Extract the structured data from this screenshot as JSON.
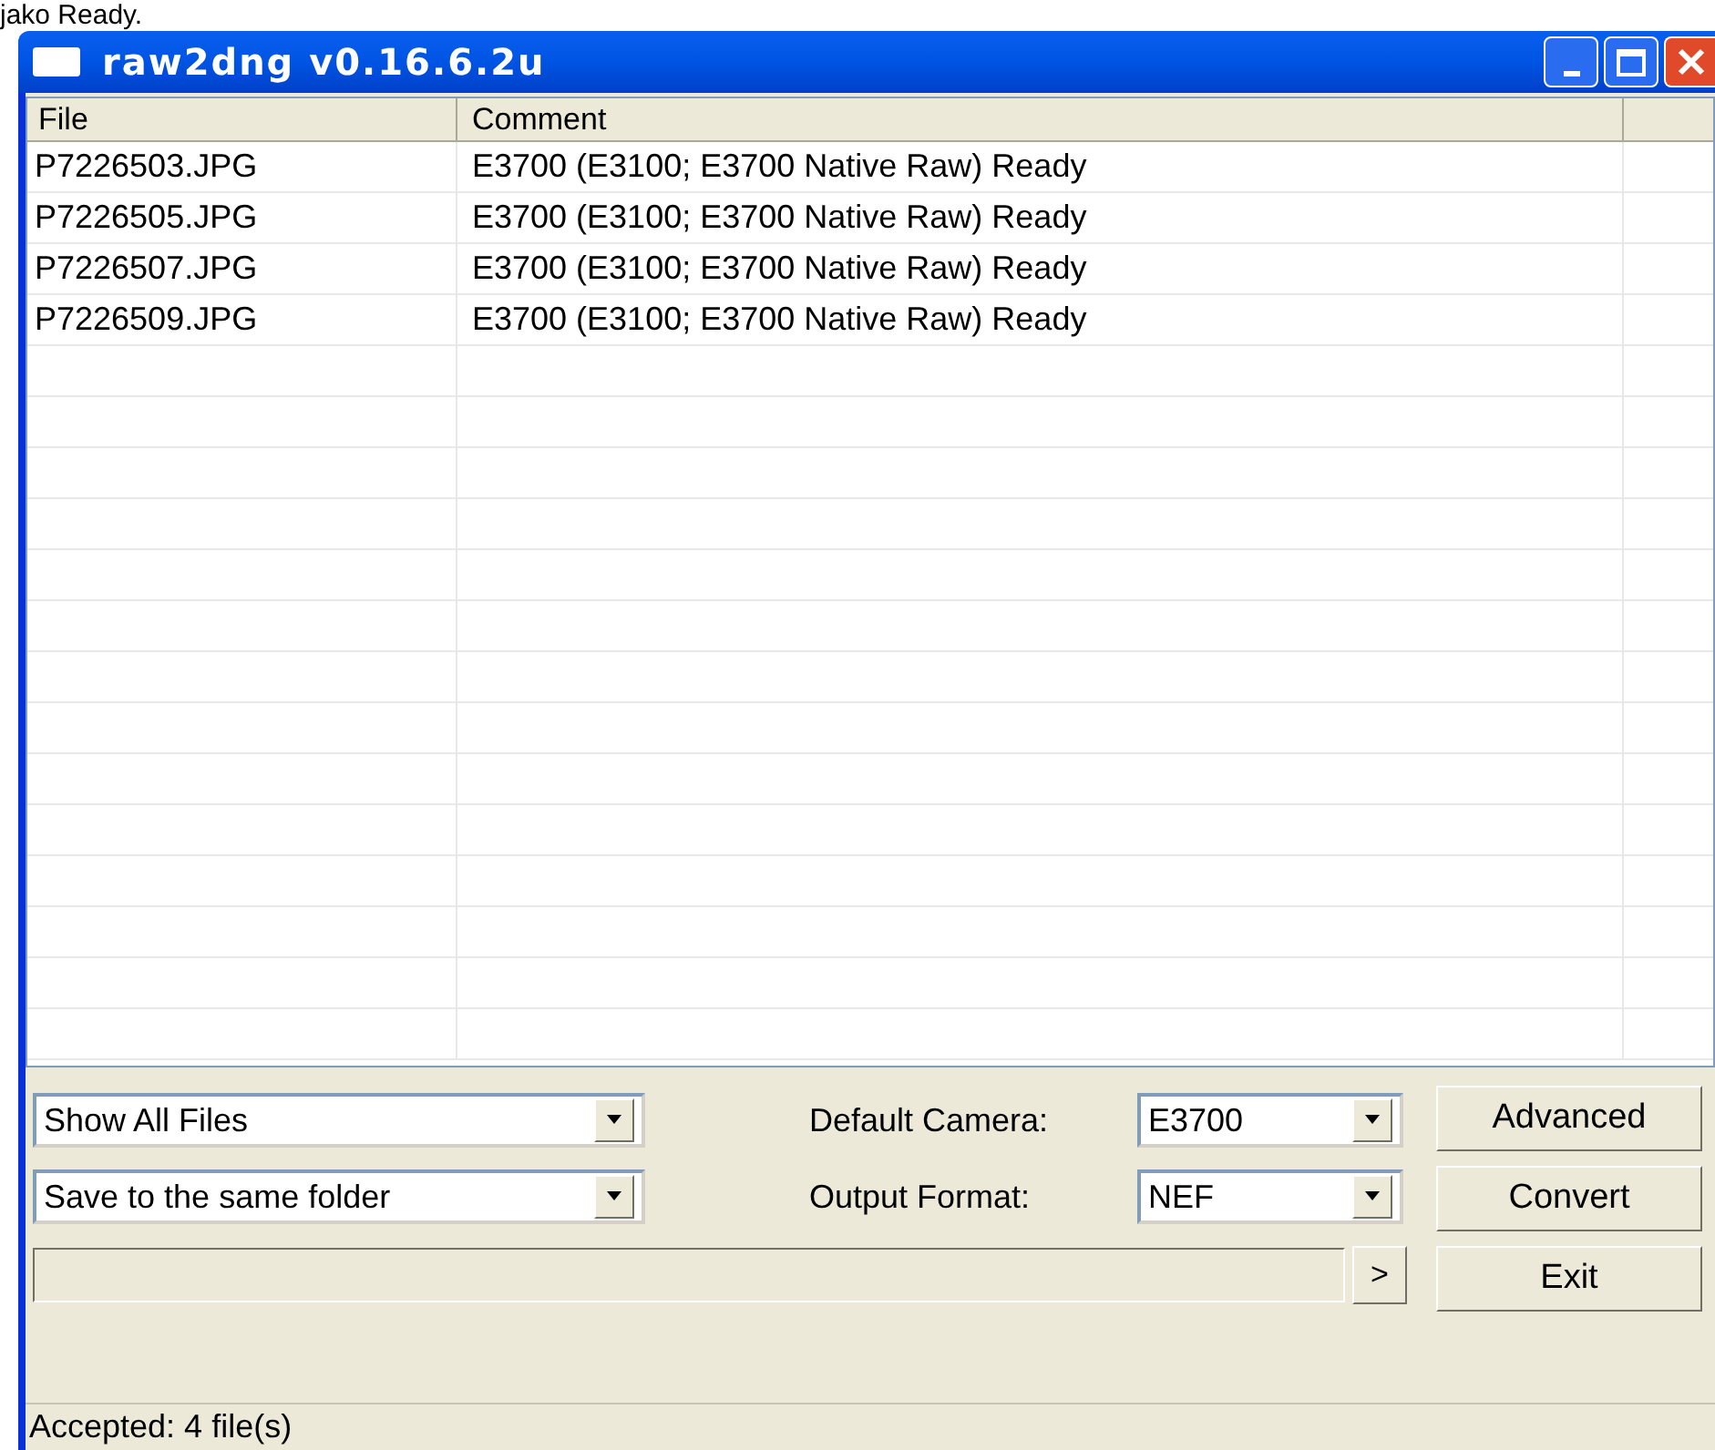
{
  "background_text": "jako Ready.",
  "window": {
    "title": "raw2dng v0.16.6.2u"
  },
  "table": {
    "columns": [
      "File",
      "Comment"
    ],
    "rows": [
      {
        "file": "P7226503.JPG",
        "comment": "E3700 (E3100; E3700 Native Raw) Ready"
      },
      {
        "file": "P7226505.JPG",
        "comment": "E3700 (E3100; E3700 Native Raw) Ready"
      },
      {
        "file": "P7226507.JPG",
        "comment": "E3700 (E3100; E3700 Native Raw) Ready"
      },
      {
        "file": "P7226509.JPG",
        "comment": "E3700 (E3100; E3700 Native Raw) Ready"
      }
    ]
  },
  "filter_dropdown": {
    "value": "Show All Files"
  },
  "destination_dropdown": {
    "value": "Save to the same folder"
  },
  "default_camera": {
    "label": "Default Camera:",
    "value": "E3700"
  },
  "output_format": {
    "label": "Output Format:",
    "value": "NEF"
  },
  "more_button": ">",
  "buttons": [
    "Advanced",
    "Convert",
    "Exit"
  ],
  "status_bar": "Accepted: 4 file(s)"
}
